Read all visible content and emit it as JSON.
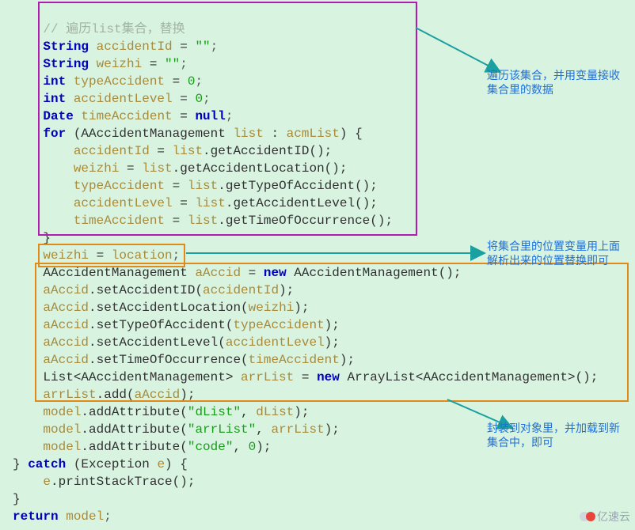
{
  "annotations": {
    "a1": "遍历该集合，并用变量接收集合里的数据",
    "a2": "将集合里的位置变量用上面解析出来的位置替换即可",
    "a3": "封装到对象里，并加载到新集合中，即可"
  },
  "logo_text": "亿速云",
  "code": {
    "l01_cmt": "// 遍历list集合，替换",
    "l02_a": "String ",
    "l02_b": "accidentId",
    "l02_c": " = ",
    "l02_d": "\"\"",
    "l02_e": ";",
    "l03_a": "String ",
    "l03_b": "weizhi",
    "l03_c": " = ",
    "l03_d": "\"\"",
    "l03_e": ";",
    "l04_a": "int ",
    "l04_b": "typeAccident",
    "l04_c": " = ",
    "l04_d": "0",
    "l04_e": ";",
    "l05_a": "int ",
    "l05_b": "accidentLevel",
    "l05_c": " = ",
    "l05_d": "0",
    "l05_e": ";",
    "l06_a": "Date ",
    "l06_b": "timeAccident",
    "l06_c": " = ",
    "l06_d": "null",
    "l06_e": ";",
    "l07_a": "for ",
    "l07_b": "(AAccidentManagement ",
    "l07_c": "list",
    "l07_d": " : ",
    "l07_e": "acmList",
    "l07_f": ") {",
    "l08_a": "accidentId",
    "l08_b": " = ",
    "l08_c": "list",
    "l08_d": ".getAccidentID();",
    "l09_a": "weizhi",
    "l09_b": " = ",
    "l09_c": "list",
    "l09_d": ".getAccidentLocation();",
    "l10_a": "typeAccident",
    "l10_b": " = ",
    "l10_c": "list",
    "l10_d": ".getTypeOfAccident();",
    "l11_a": "accidentLevel",
    "l11_b": " = ",
    "l11_c": "list",
    "l11_d": ".getAccidentLevel();",
    "l12_a": "timeAccident",
    "l12_b": " = ",
    "l12_c": "list",
    "l12_d": ".getTimeOfOccurrence();",
    "l13": "}",
    "l14_a": "weizhi",
    "l14_b": " = ",
    "l14_c": "location",
    "l14_d": ";",
    "l15_a": "AAccidentManagement ",
    "l15_b": "aAccid",
    "l15_c": " = ",
    "l15_d": "new ",
    "l15_e": "AAccidentManagement();",
    "l16_a": "aAccid",
    "l16_b": ".setAccidentID(",
    "l16_c": "accidentId",
    "l16_d": ");",
    "l17_a": "aAccid",
    "l17_b": ".setAccidentLocation(",
    "l17_c": "weizhi",
    "l17_d": ");",
    "l18_a": "aAccid",
    "l18_b": ".setTypeOfAccident(",
    "l18_c": "typeAccident",
    "l18_d": ");",
    "l19_a": "aAccid",
    "l19_b": ".setAccidentLevel(",
    "l19_c": "accidentLevel",
    "l19_d": ");",
    "l20_a": "aAccid",
    "l20_b": ".setTimeOfOccurrence(",
    "l20_c": "timeAccident",
    "l20_d": ");",
    "l21_a": "List<AAccidentManagement> ",
    "l21_b": "arrList",
    "l21_c": " = ",
    "l21_d": "new ",
    "l21_e": "ArrayList<AAccidentManagement>();",
    "l22_a": "arrList",
    "l22_b": ".add(",
    "l22_c": "aAccid",
    "l22_d": ");",
    "l23_a": "model",
    "l23_b": ".addAttribute(",
    "l23_c": "\"dList\"",
    "l23_d": ", ",
    "l23_e": "dList",
    "l23_f": ");",
    "l24_a": "model",
    "l24_b": ".addAttribute(",
    "l24_c": "\"arrList\"",
    "l24_d": ", ",
    "l24_e": "arrList",
    "l24_f": ");",
    "l25_a": "model",
    "l25_b": ".addAttribute(",
    "l25_c": "\"code\"",
    "l25_d": ", ",
    "l25_e": "0",
    "l25_f": ");",
    "l26_a": "} ",
    "l26_b": "catch ",
    "l26_c": "(Exception ",
    "l26_d": "e",
    "l26_e": ") {",
    "l27_a": "e",
    "l27_b": ".printStackTrace();",
    "l28": "}",
    "l29_a": "return ",
    "l29_b": "model",
    "l29_c": ";"
  }
}
